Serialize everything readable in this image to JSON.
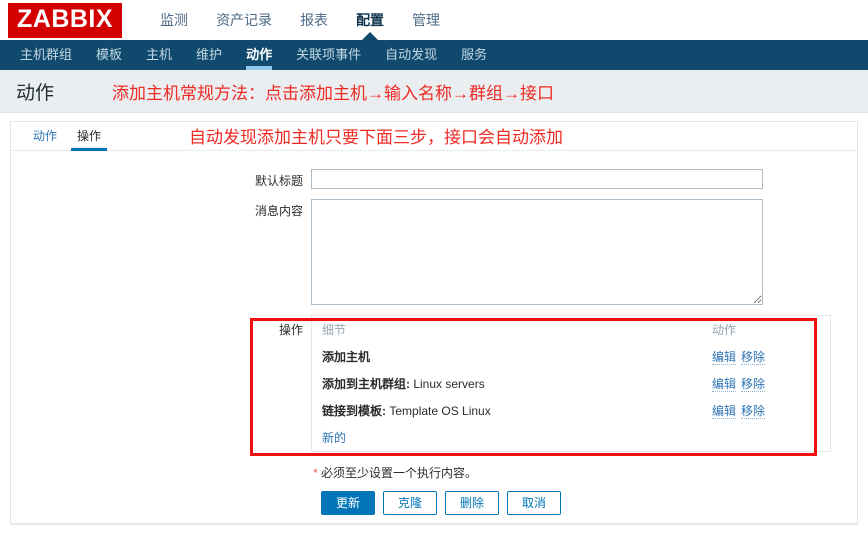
{
  "brand": {
    "logo_text": "ZABBIX",
    "logo_bg": "#d40000"
  },
  "topnav": {
    "items": [
      {
        "label": "监测",
        "active": false
      },
      {
        "label": "资产记录",
        "active": false
      },
      {
        "label": "报表",
        "active": false
      },
      {
        "label": "配置",
        "active": true
      },
      {
        "label": "管理",
        "active": false
      }
    ]
  },
  "subnav": {
    "bg": "#0f4a6e",
    "items": [
      {
        "label": "主机群组",
        "active": false
      },
      {
        "label": "模板",
        "active": false
      },
      {
        "label": "主机",
        "active": false
      },
      {
        "label": "维护",
        "active": false
      },
      {
        "label": "动作",
        "active": true
      },
      {
        "label": "关联项事件",
        "active": false
      },
      {
        "label": "自动发现",
        "active": false
      },
      {
        "label": "服务",
        "active": false
      }
    ]
  },
  "page": {
    "title": "动作",
    "annotation_top": "添加主机常规方法：点击添加主机→输入名称→群组→接口",
    "annotation_mid": "自动发现添加主机只要下面三步，接口会自动添加",
    "annotation_color": "#ee2a24"
  },
  "tabs": [
    {
      "label": "动作",
      "active": false
    },
    {
      "label": "操作",
      "active": true
    }
  ],
  "form": {
    "default_subject": {
      "label": "默认标题",
      "value": "",
      "placeholder": ""
    },
    "message": {
      "label": "消息内容",
      "value": "",
      "placeholder": ""
    },
    "operations_label": "操作"
  },
  "operations_table": {
    "headers": {
      "details": "细节",
      "action": "动作"
    },
    "edit_label": "编辑",
    "remove_label": "移除",
    "new_label": "新的",
    "rows": [
      {
        "name": "添加主机",
        "value": ""
      },
      {
        "name": "添加到主机群组:",
        "value": "Linux servers"
      },
      {
        "name": "链接到模板:",
        "value": "Template OS Linux"
      }
    ]
  },
  "footer": {
    "required_star": "*",
    "required_note": "必须至少设置一个执行内容。",
    "buttons": [
      {
        "label": "更新",
        "primary": true
      },
      {
        "label": "克隆",
        "primary": false
      },
      {
        "label": "删除",
        "primary": false
      },
      {
        "label": "取消",
        "primary": false
      }
    ]
  }
}
